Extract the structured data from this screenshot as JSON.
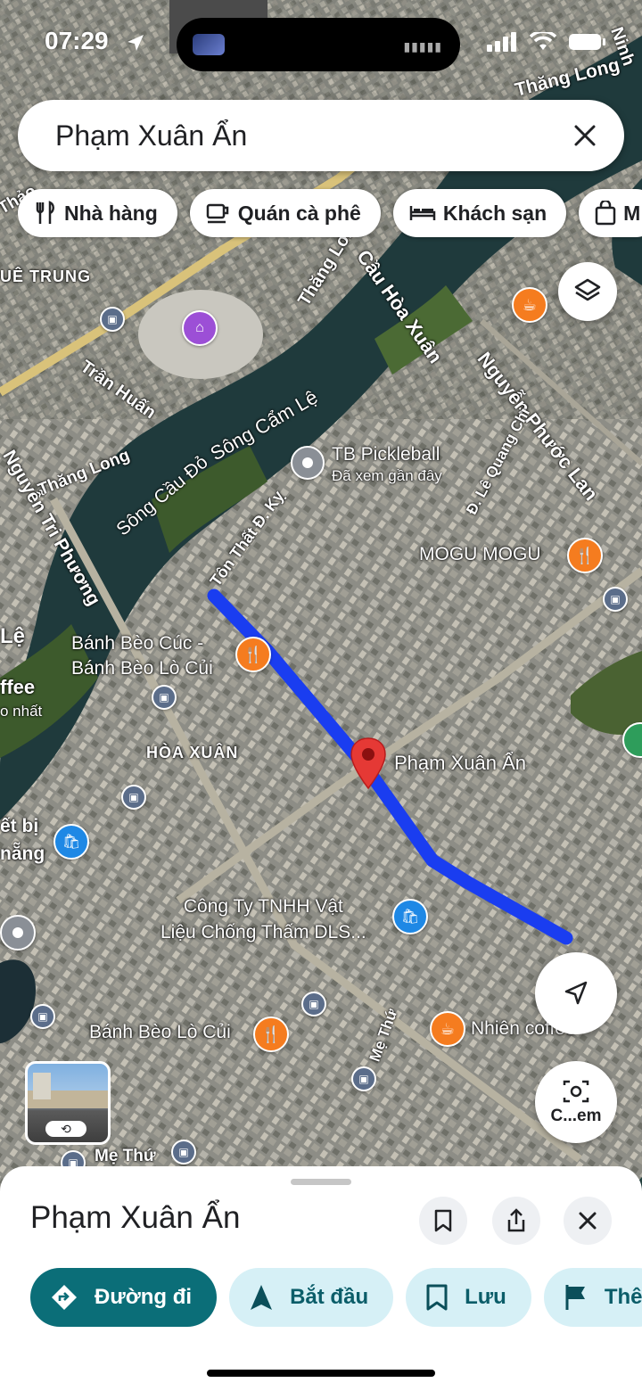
{
  "status_bar": {
    "time": "07:29"
  },
  "search": {
    "query": "Phạm Xuân Ẩn"
  },
  "chips": [
    {
      "label": "Nhà hàng",
      "icon": "fork-knife-icon"
    },
    {
      "label": "Quán cà phê",
      "icon": "coffee-cup-icon"
    },
    {
      "label": "Khách sạn",
      "icon": "bed-icon"
    },
    {
      "label": "M",
      "icon": "shopping-bag-icon"
    }
  ],
  "map": {
    "road_labels": {
      "thang_long_top": "Thăng Long",
      "thang_long_mid": "Thăng Long",
      "thang_long_left": "Thăng Long",
      "cau_hoa_xuan": "Cầu Hòa Xuân",
      "nguyen_phuoc_lan": "Nguyễn Phước Lan",
      "tran_huan": "Trần Huấn",
      "song_cam_le": "Sông Cẩm Lệ",
      "song_cau_do": "Sông Cầu Đỏ",
      "le_quang_chi": "Đ. Lê Quang Chi",
      "ton_that_dky": "Tôn Thất Đ. Kỵ",
      "nguyen_tri_phuong": "Nguyễn Tri Phương",
      "me_thu_1": "Mẹ Thứ",
      "me_thu_2": "Mẹ Thứ",
      "hue_trung": "UÊ TRUNG",
      "hoa_xuan": "HÒA XUÂN",
      "edge_ninh": "Ninh",
      "edge_thao": "Thảo",
      "edge_le": "Lệ",
      "edge_ffee": "ffee",
      "edge_o_nhat": "o nhất",
      "edge_thiet_bi": "ết bị",
      "edge_nang": "nẵng"
    },
    "places": {
      "tb_pickleball": {
        "name": "TB Pickleball",
        "sub": "Đã xem gần đây"
      },
      "mogu": "MOGU MOGU",
      "banh_beo_cuc": "Bánh Bèo Cúc -\nBánh Bèo Lò Củi",
      "selected": "Phạm Xuân Ẩn",
      "cong_ty": "Công Ty TNHH Vật\nLiệu Chống Thấm DLS...",
      "banh_beo_lo_cui": "Bánh Bèo Lò Củi",
      "nhien_coffee": "Nhiên coffee"
    },
    "camera_label": "C...em"
  },
  "sheet": {
    "title": "Phạm Xuân Ẩn",
    "actions": [
      {
        "label": "Đường đi",
        "icon": "directions-icon",
        "style": "primary"
      },
      {
        "label": "Bắt đầu",
        "icon": "navigation-arrow-icon",
        "style": "secondary"
      },
      {
        "label": "Lưu",
        "icon": "bookmark-icon",
        "style": "secondary"
      },
      {
        "label": "Thê",
        "icon": "flag-icon",
        "style": "secondary"
      }
    ]
  },
  "colors": {
    "route": "#1a3df0",
    "pin": "#e53935",
    "primary_button": "#0b6e78",
    "secondary_button": "#d6f0f6",
    "restaurant_pin": "#f57c1f",
    "shop_pin": "#1e88e5"
  }
}
